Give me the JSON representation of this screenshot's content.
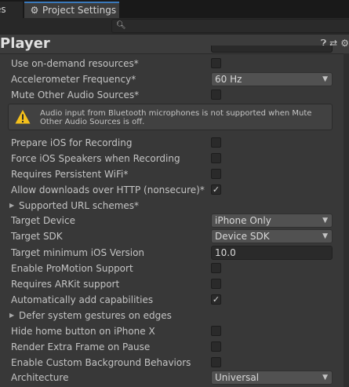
{
  "tabs": [
    {
      "label": "es"
    },
    {
      "label": "Project Settings"
    }
  ],
  "search": {
    "placeholder": ""
  },
  "header": {
    "title": "Player"
  },
  "settings": [
    {
      "label": "Use on-demand resources*",
      "control": "checkbox",
      "checked": false
    },
    {
      "label": "Accelerometer Frequency*",
      "control": "dropdown",
      "value": "60 Hz"
    },
    {
      "label": "Mute Other Audio Sources*",
      "control": "checkbox",
      "checked": false
    },
    {
      "label": "Prepare iOS for Recording",
      "control": "checkbox",
      "checked": false
    },
    {
      "label": "Force iOS Speakers when Recording",
      "control": "checkbox",
      "checked": false
    },
    {
      "label": "Requires Persistent WiFi*",
      "control": "checkbox",
      "checked": false
    },
    {
      "label": "Allow downloads over HTTP (nonsecure)*",
      "control": "checkbox",
      "checked": true
    },
    {
      "label": "Supported URL schemes*",
      "control": "foldout"
    },
    {
      "label": "Target Device",
      "control": "dropdown",
      "value": "iPhone Only"
    },
    {
      "label": "Target SDK",
      "control": "dropdown",
      "value": "Device SDK"
    },
    {
      "label": "Target minimum iOS Version",
      "control": "text",
      "value": "10.0"
    },
    {
      "label": "Enable ProMotion Support",
      "control": "checkbox",
      "checked": false
    },
    {
      "label": "Requires ARKit support",
      "control": "checkbox",
      "checked": false
    },
    {
      "label": "Automatically add capabilities",
      "control": "checkbox",
      "checked": true
    },
    {
      "label": "Defer system gestures on edges",
      "control": "foldout"
    },
    {
      "label": "Hide home button on iPhone X",
      "control": "checkbox",
      "checked": false
    },
    {
      "label": "Render Extra Frame on Pause",
      "control": "checkbox",
      "checked": false
    },
    {
      "label": "Enable Custom Background Behaviors",
      "control": "checkbox",
      "checked": false
    },
    {
      "label": "Architecture",
      "control": "dropdown",
      "value": "Universal"
    }
  ],
  "warning": {
    "message": "Audio input from Bluetooth microphones is not supported when Mute Other Audio Sources is off."
  },
  "colors": {
    "accent": "#3a79bb",
    "warning": "#f4c01b",
    "background": "#383838"
  }
}
